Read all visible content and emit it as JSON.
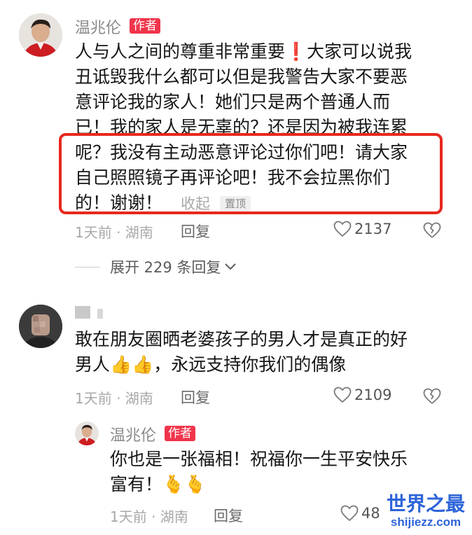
{
  "comment1": {
    "author": "温兆伦",
    "badge": "作者",
    "lines": [
      "人与人之间的尊重非常重要❗️大家可以说我",
      "丑诋毁我什么都可以但是我警告大家不要恶",
      "意评论我的家人！她们只是两个普通人而",
      "已！我的家人是无辜的？还是因为被我连累",
      "呢？我没有主动恶意评论过你们吧！请大家",
      "自己照照镜子再评论吧！我不会拉黑你们",
      "的！谢谢！"
    ],
    "collapse_label": "收起",
    "pinned_label": "置顶",
    "meta": "1天前 · 湖南",
    "reply_label": "回复",
    "likes": "2137",
    "expand_label": "展开 229 条回复"
  },
  "comment2": {
    "username": "",
    "lines": [
      "敢在朋友圈晒老婆孩子的男人才是真正的好",
      "男人👍👍，永远支持你我们的偶像"
    ],
    "meta": "1天前 · 湖南",
    "reply_label": "回复",
    "likes": "2109"
  },
  "reply1": {
    "author": "温兆伦",
    "badge": "作者",
    "lines": [
      "你也是一张福相！祝福你一生平安快乐",
      "富有！🫰🫰"
    ],
    "meta": "1天前 · 湖南",
    "reply_label": "回复",
    "likes": "48"
  },
  "watermark": {
    "title": "世界之最",
    "url": "shijiezz.com"
  },
  "colors": {
    "badge": "#f0354b",
    "highlight_border": "#e8281e",
    "watermark": "#2d64d8"
  }
}
